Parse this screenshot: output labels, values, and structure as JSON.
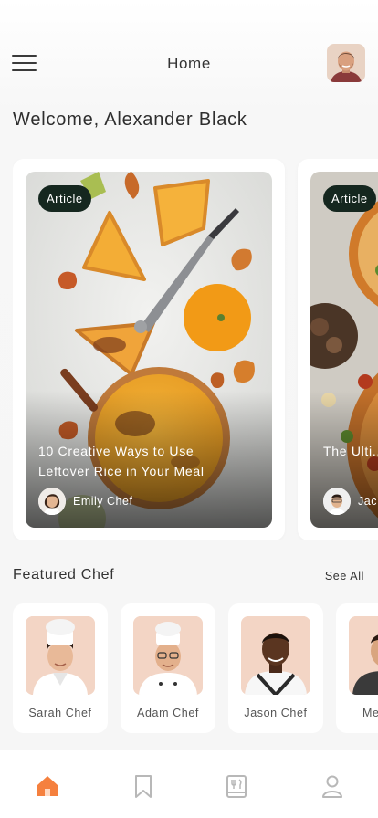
{
  "header": {
    "title": "Home",
    "menu_icon": "hamburger-menu-icon",
    "profile_icon": "user-avatar"
  },
  "welcome": "Welcome, Alexander Black",
  "articles": [
    {
      "badge": "Article",
      "title": "10 Creative Ways to Use Leftover Rice in Your Meal",
      "author": "Emily Chef"
    },
    {
      "badge": "Article",
      "title": "The Ulti... the Perf...",
      "author": "Jac..."
    }
  ],
  "featured": {
    "title": "Featured Chef",
    "see_all": "See All",
    "chefs": [
      {
        "name": "Sarah Chef"
      },
      {
        "name": "Adam Chef"
      },
      {
        "name": "Jason Chef"
      },
      {
        "name": "Mega..."
      }
    ]
  },
  "bottom_nav": [
    {
      "icon": "home-icon",
      "active": true
    },
    {
      "icon": "bookmark-icon",
      "active": false
    },
    {
      "icon": "recipe-book-icon",
      "active": false
    },
    {
      "icon": "profile-icon",
      "active": false
    }
  ],
  "colors": {
    "accent": "#f5803e",
    "badge_bg": "#15271f",
    "nav_inactive": "#b8b8b8",
    "background": "#f6f6f6"
  }
}
